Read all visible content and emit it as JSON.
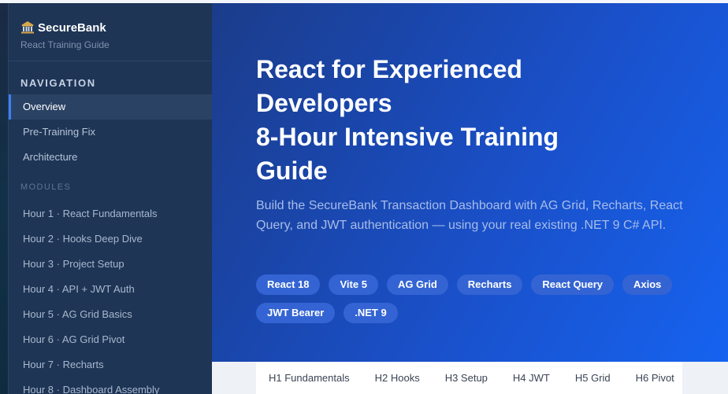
{
  "brand": {
    "icon": "bank-icon",
    "name": "SecureBank",
    "subtitle": "React Training Guide"
  },
  "navigation": {
    "title": "NAVIGATION",
    "items": [
      {
        "label": "Overview",
        "active": true
      },
      {
        "label": "Pre-Training Fix",
        "active": false
      },
      {
        "label": "Architecture",
        "active": false
      }
    ]
  },
  "modules": {
    "title": "MODULES",
    "items": [
      {
        "label": "Hour 1 · React Fundamentals"
      },
      {
        "label": "Hour 2 · Hooks Deep Dive"
      },
      {
        "label": "Hour 3 · Project Setup"
      },
      {
        "label": "Hour 4 · API + JWT Auth"
      },
      {
        "label": "Hour 5 · AG Grid Basics"
      },
      {
        "label": "Hour 6 · AG Grid Pivot"
      },
      {
        "label": "Hour 7 · Recharts"
      },
      {
        "label": "Hour 8 · Dashboard Assembly"
      }
    ]
  },
  "hero": {
    "title_lines": [
      "React for Experienced",
      "Developers",
      "8-Hour Intensive Training",
      "Guide"
    ],
    "subtitle": "Build the SecureBank Transaction Dashboard with AG Grid, Recharts, React Query, and JWT authentication — using your real existing .NET 9 C# API.",
    "tags": [
      "React 18",
      "Vite 5",
      "AG Grid",
      "Recharts",
      "React Query",
      "Axios",
      "JWT Bearer",
      ".NET 9"
    ]
  },
  "tabs": [
    "H1 Fundamentals",
    "H2 Hooks",
    "H3 Setup",
    "H4 JWT",
    "H5 Grid",
    "H6 Pivot"
  ],
  "colors": {
    "sidebar_bg": "#1e3556",
    "accent": "#3c82f6",
    "hero_start": "#1b3c8a",
    "hero_end": "#1663f0",
    "tag_bg": "#3464d3"
  }
}
